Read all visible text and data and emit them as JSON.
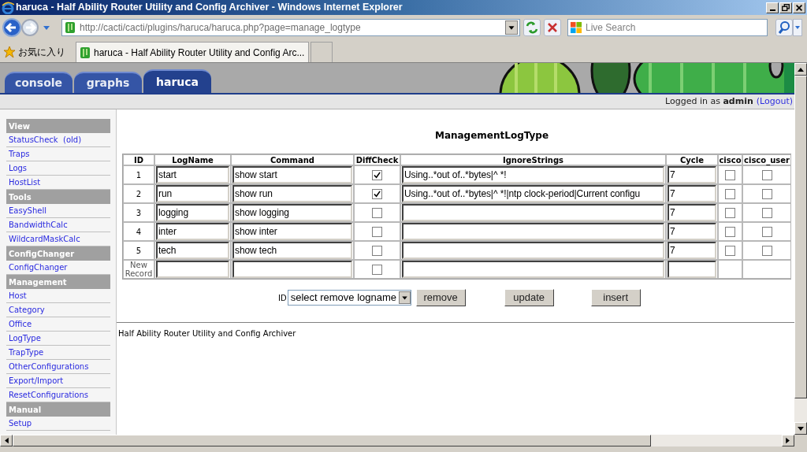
{
  "window": {
    "title": "haruca - Half Ability Router Utility and Config Archiver - Windows Internet Explorer"
  },
  "toolbar": {
    "address": "http://cacti/cacti/plugins/haruca/haruca.php?page=manage_logtype",
    "search_placeholder": "Live Search"
  },
  "favorites": {
    "label": "お気に入り",
    "tab_title": "haruca - Half Ability Router Utility and Config Arc..."
  },
  "nav_tabs": [
    {
      "label": "console",
      "selected": false
    },
    {
      "label": "graphs",
      "selected": false
    },
    {
      "label": "haruca",
      "selected": true
    }
  ],
  "login": {
    "text": "Logged in as **admin**",
    "logout": "(Logout)"
  },
  "sidebar": [
    {
      "heading": "View",
      "items": [
        "StatusCheck  (old)",
        "Traps",
        "Logs",
        "HostList"
      ]
    },
    {
      "heading": "Tools",
      "items": [
        "EasyShell",
        "BandwidthCalc",
        "WildcardMaskCalc"
      ]
    },
    {
      "heading": "ConfigChanger",
      "items": [
        "ConfigChanger"
      ]
    },
    {
      "heading": "Management",
      "items": [
        "Host",
        "Category",
        "Office",
        "LogType",
        "TrapType",
        "OtherConfigurations",
        "Export/Import",
        "ResetConfigurations"
      ]
    },
    {
      "heading": "Manual",
      "items": [
        "Setup"
      ]
    }
  ],
  "page_title": "ManagementLogType",
  "table": {
    "columns": [
      "ID",
      "LogName",
      "Command",
      "DiffCheck",
      "IgnoreStrings",
      "Cycle",
      "cisco",
      "cisco_user"
    ],
    "rows": [
      {
        "kind": "record",
        "id": "1",
        "logname": "start",
        "command": "show start",
        "diffcheck": true,
        "ignore": "Using..*out of..*bytes|^ *!",
        "cycle": "7",
        "cisco": false,
        "cisco_user": false
      },
      {
        "kind": "record",
        "id": "2",
        "logname": "run",
        "command": "show run",
        "diffcheck": true,
        "ignore": "Using..*out of..*bytes|^ *!|ntp clock-period|Current configu",
        "cycle": "7",
        "cisco": false,
        "cisco_user": false
      },
      {
        "kind": "record",
        "id": "3",
        "logname": "logging",
        "command": "show logging",
        "diffcheck": false,
        "cycle": "7",
        "cisco": false,
        "cisco_user": false
      },
      {
        "kind": "record",
        "id": "4",
        "logname": "inter",
        "command": "show inter",
        "diffcheck": false,
        "cycle": "7",
        "cisco": false,
        "cisco_user": false
      },
      {
        "kind": "record",
        "id": "5",
        "logname": "tech",
        "command": "show tech",
        "diffcheck": false,
        "cycle": "7",
        "cisco": false,
        "cisco_user": false
      },
      {
        "kind": "new",
        "id": "New Record",
        "diffcheck": false
      }
    ]
  },
  "actions": {
    "id_label": "ID",
    "select": "select remove logname",
    "buttons": [
      "remove",
      "update",
      "insert"
    ]
  },
  "footer": "Half Ability Router Utility and Config Archiver"
}
